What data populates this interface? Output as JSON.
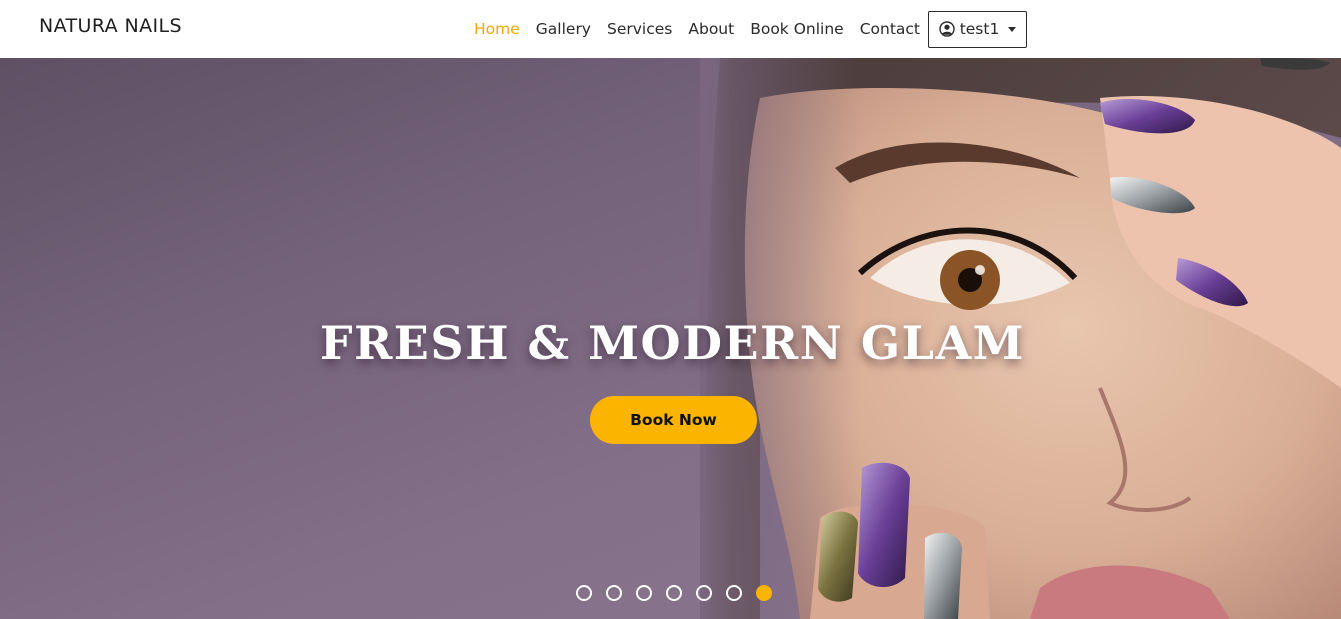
{
  "navbar": {
    "brand": "NATURA NAILS",
    "links": [
      {
        "label": "Home",
        "active": true
      },
      {
        "label": "Gallery",
        "active": false
      },
      {
        "label": "Services",
        "active": false
      },
      {
        "label": "About",
        "active": false
      },
      {
        "label": "Book Online",
        "active": false
      },
      {
        "label": "Contact",
        "active": false
      }
    ],
    "user": {
      "name": "test1",
      "icon": "user-circle-icon"
    }
  },
  "hero": {
    "title": "FRESH & MODERN GLAM",
    "cta_label": "Book Now",
    "slide_count": 7,
    "active_slide": 7
  },
  "colors": {
    "accent": "#fbb500",
    "nav_active": "#f5a800",
    "hero_overlay": "#7a677f"
  }
}
